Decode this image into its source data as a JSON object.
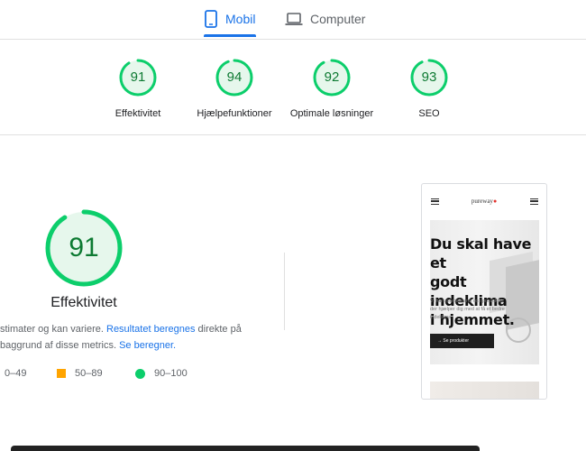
{
  "tabs": [
    {
      "label": "Mobil",
      "icon": "smartphone-icon",
      "active": true
    },
    {
      "label": "Computer",
      "icon": "laptop-icon",
      "active": false
    }
  ],
  "categories": [
    {
      "score": "91",
      "label": "Effektivitet",
      "value": 91
    },
    {
      "score": "94",
      "label": "Hjælpefunktioner",
      "value": 94
    },
    {
      "score": "92",
      "label": "Optimale løsninger",
      "value": 92
    },
    {
      "score": "93",
      "label": "SEO",
      "value": 93
    }
  ],
  "main": {
    "score": "91",
    "value": 91,
    "title": "Effektivitet",
    "desc_line1_pre": "stimater og kan variere. ",
    "desc_line1_link": "Resultatet beregnes",
    "desc_line1_post": " direkte på",
    "desc_line2_pre": "baggrund af disse metrics. ",
    "desc_line2_link": "Se beregner."
  },
  "legend": [
    {
      "label": "0–49"
    },
    {
      "label": "50–89"
    },
    {
      "label": "90–100"
    }
  ],
  "preview": {
    "logo": "pureway",
    "logo_dot": "●",
    "hero_title_1": "Du skal have et",
    "hero_title_2": "godt indeklima",
    "hero_title_3": "i hjemmet.",
    "hero_body": "Vi har specialiseret os i produkter der hjælper dig med at få et bedre indeklima",
    "button": "Se produkter",
    "button_icon": "→"
  },
  "colors": {
    "accent": "#1a73e8",
    "pass": "#0cce6b",
    "pass_text": "#0d7a32",
    "average": "#ffa400",
    "gauge_fill": "#e6f7ec"
  }
}
